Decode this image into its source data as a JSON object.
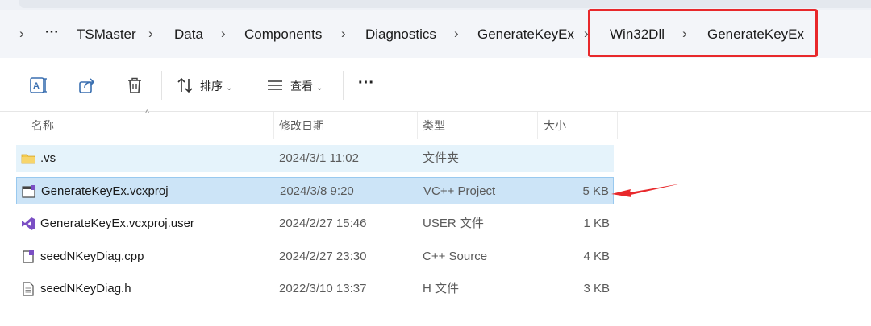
{
  "breadcrumb": {
    "items": [
      "TSMaster",
      "Data",
      "Components",
      "Diagnostics",
      "GenerateKeyEx",
      "Win32Dll",
      "GenerateKeyEx"
    ],
    "more": "···",
    "separator": "›"
  },
  "toolbar": {
    "sort_label": "排序",
    "view_label": "查看",
    "more_label": "···"
  },
  "columns": {
    "name": "名称",
    "date": "修改日期",
    "type": "类型",
    "size": "大小"
  },
  "files": [
    {
      "name": ".vs",
      "date": "2024/3/1 11:02",
      "type": "文件夹",
      "size": "",
      "icon": "folder-icon"
    },
    {
      "name": "GenerateKeyEx.vcxproj",
      "date": "2024/3/8 9:20",
      "type": "VC++ Project",
      "size": "5 KB",
      "icon": "vcxproj-icon"
    },
    {
      "name": "GenerateKeyEx.vcxproj.user",
      "date": "2024/2/27 15:46",
      "type": "USER 文件",
      "size": "1 KB",
      "icon": "visual-studio-icon"
    },
    {
      "name": "seedNKeyDiag.cpp",
      "date": "2024/2/27 23:30",
      "type": "C++ Source",
      "size": "4 KB",
      "icon": "cpp-file-icon"
    },
    {
      "name": "seedNKeyDiag.h",
      "date": "2022/3/10 13:37",
      "type": "H 文件",
      "size": "3 KB",
      "icon": "header-file-icon"
    }
  ],
  "colors": {
    "annotation": "#e8282b",
    "selection": "#cce4f7",
    "hover": "#e5f3fb"
  }
}
